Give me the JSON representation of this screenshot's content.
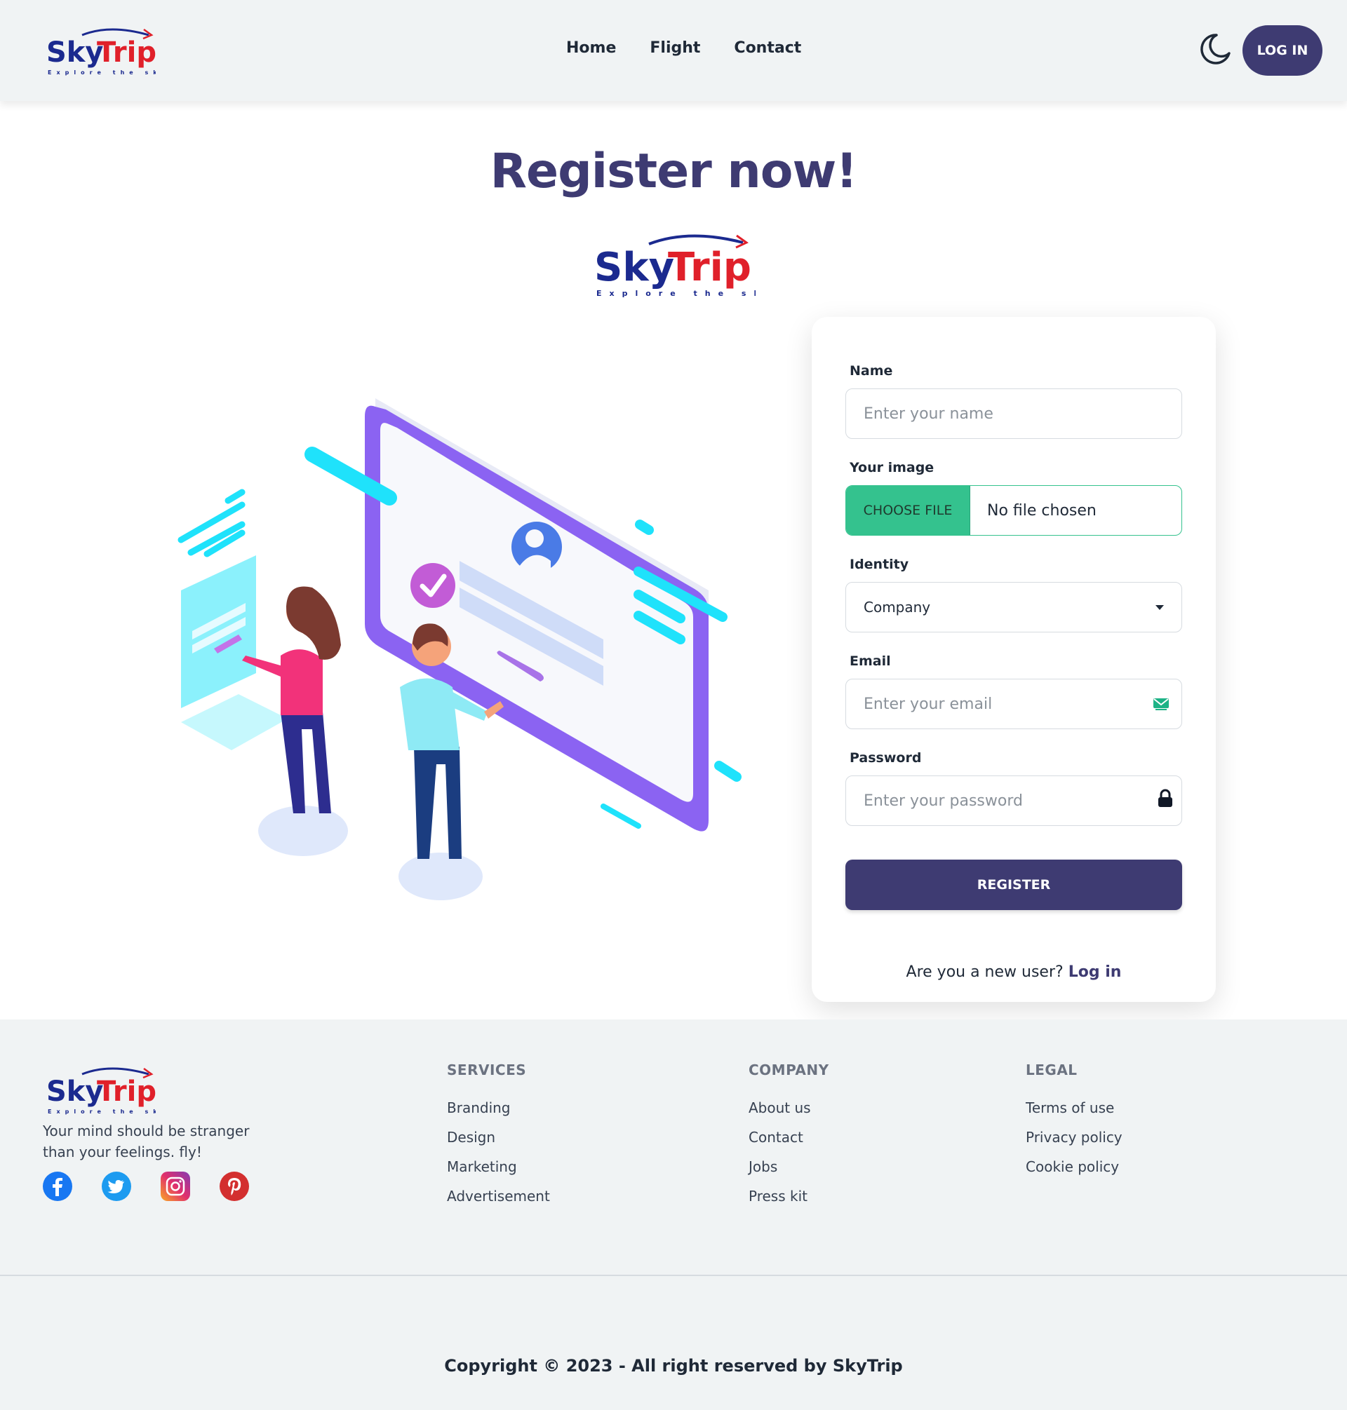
{
  "brand": {
    "name_part1": "Sky",
    "name_part2": "Trip",
    "tagline": "Explore the sky",
    "primary_color": "#3e3b72",
    "accent_color": "#e0202a",
    "logo_blue": "#1b2a8f"
  },
  "header": {
    "nav": [
      "Home",
      "Flight",
      "Contact"
    ],
    "theme_toggle_icon": "moon-icon",
    "login_label": "LOG IN"
  },
  "main": {
    "title": "Register now!",
    "form": {
      "name_label": "Name",
      "name_placeholder": "Enter your name",
      "image_label": "Your image",
      "choose_file_label": "CHOOSE FILE",
      "file_status": "No file chosen",
      "identity_label": "Identity",
      "identity_value": "Company",
      "email_label": "Email",
      "email_placeholder": "Enter your email",
      "password_label": "Password",
      "password_placeholder": "Enter your password",
      "register_label": "REGISTER",
      "new_user_text": "Are you a new user?",
      "login_link": "Log in"
    }
  },
  "footer": {
    "tagline": "Your mind should be stranger than your feelings. fly!",
    "socials": [
      "facebook-icon",
      "twitter-icon",
      "instagram-icon",
      "pinterest-icon"
    ],
    "columns": [
      {
        "title": "SERVICES",
        "links": [
          "Branding",
          "Design",
          "Marketing",
          "Advertisement"
        ]
      },
      {
        "title": "COMPANY",
        "links": [
          "About us",
          "Contact",
          "Jobs",
          "Press kit"
        ]
      },
      {
        "title": "LEGAL",
        "links": [
          "Terms of use",
          "Privacy policy",
          "Cookie policy"
        ]
      }
    ],
    "copyright": "Copyright © 2023 - All right reserved by SkyTrip"
  }
}
